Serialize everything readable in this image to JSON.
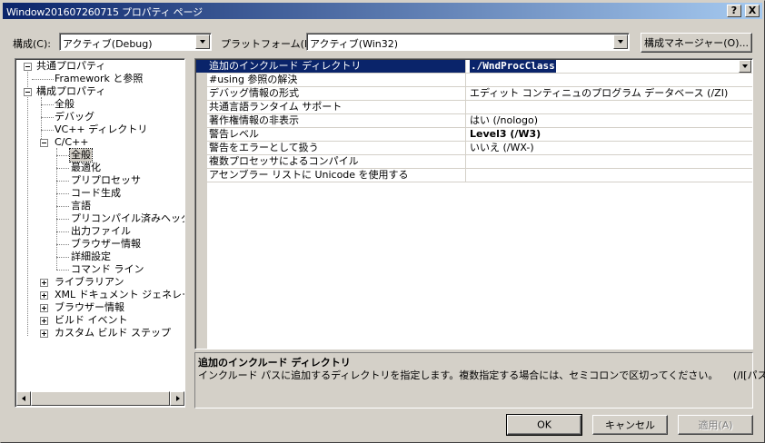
{
  "window": {
    "title": "Window201607260715 プロパティ ページ",
    "help_label": "?",
    "close_label": "X"
  },
  "config": {
    "label": "構成(C):",
    "value": "アクティブ(Debug)"
  },
  "platform": {
    "label": "プラットフォーム(P):",
    "value": "アクティブ(Win32)"
  },
  "config_manager_label": "構成マネージャー(O)...",
  "tree": {
    "items": [
      {
        "label": "共通プロパティ"
      },
      {
        "label": "Framework と参照"
      },
      {
        "label": "構成プロパティ"
      },
      {
        "label": "全般"
      },
      {
        "label": "デバッグ"
      },
      {
        "label": "VC++ ディレクトリ"
      },
      {
        "label": "C/C++"
      },
      {
        "label": "全般"
      },
      {
        "label": "最適化"
      },
      {
        "label": "プリプロセッサ"
      },
      {
        "label": "コード生成"
      },
      {
        "label": "言語"
      },
      {
        "label": "プリコンパイル済みヘッダー"
      },
      {
        "label": "出力ファイル"
      },
      {
        "label": "ブラウザー情報"
      },
      {
        "label": "詳細設定"
      },
      {
        "label": "コマンド ライン"
      },
      {
        "label": "ライブラリアン"
      },
      {
        "label": "XML ドキュメント ジェネレーター"
      },
      {
        "label": "ブラウザー情報"
      },
      {
        "label": "ビルド イベント"
      },
      {
        "label": "カスタム ビルド ステップ"
      }
    ]
  },
  "properties": [
    {
      "name": "追加のインクルード ディレクトリ",
      "value": "./WndProcClass"
    },
    {
      "name": "#using 参照の解決",
      "value": ""
    },
    {
      "name": "デバッグ情報の形式",
      "value": "エディット コンティニュのプログラム データベース (/ZI)"
    },
    {
      "name": "共通言語ランタイム サポート",
      "value": ""
    },
    {
      "name": "著作権情報の非表示",
      "value": "はい (/nologo)"
    },
    {
      "name": "警告レベル",
      "value": "Level3 (/W3)"
    },
    {
      "name": "警告をエラーとして扱う",
      "value": "いいえ (/WX-)"
    },
    {
      "name": "複数プロセッサによるコンパイル",
      "value": ""
    },
    {
      "name": "アセンブラー リストに Unicode を使用する",
      "value": ""
    }
  ],
  "description": {
    "title": "追加のインクルード ディレクトリ",
    "text": "インクルード パスに追加するディレクトリを指定します。複数指定する場合には、セミコロンで区切ってください。　　(/I[パス])"
  },
  "buttons": {
    "ok": "OK",
    "cancel": "キャンセル",
    "apply": "適用(A)"
  },
  "colors": {
    "selection": "#0a246a",
    "face": "#d4d0c8"
  }
}
